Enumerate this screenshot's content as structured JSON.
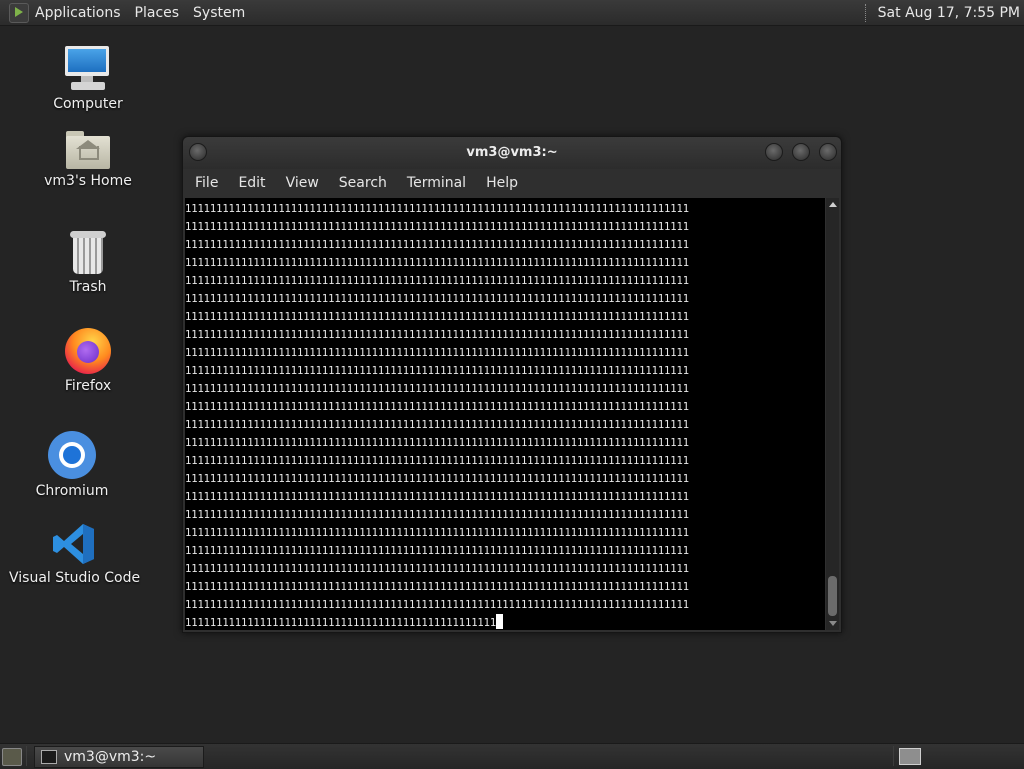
{
  "top_panel": {
    "menus": [
      "Applications",
      "Places",
      "System"
    ],
    "clock": "Sat Aug 17,  7:55 PM"
  },
  "desktop": {
    "icons": [
      {
        "label": "Computer",
        "icon": "computer-icon"
      },
      {
        "label": "vm3's Home",
        "icon": "home-folder-icon"
      },
      {
        "label": "Trash",
        "icon": "trash-icon"
      },
      {
        "label": "Firefox",
        "icon": "firefox-icon"
      },
      {
        "label": "Chromium",
        "icon": "chromium-icon"
      },
      {
        "label": "Visual Studio Code",
        "icon": "vscode-icon"
      }
    ]
  },
  "terminal": {
    "title": "vm3@vm3:~",
    "menus": [
      "File",
      "Edit",
      "View",
      "Search",
      "Terminal",
      "Help"
    ],
    "lines": [
      "111111111111111111111111111111111111111111111111111111111111111111111111111111111",
      "111111111111111111111111111111111111111111111111111111111111111111111111111111111",
      "111111111111111111111111111111111111111111111111111111111111111111111111111111111",
      "111111111111111111111111111111111111111111111111111111111111111111111111111111111",
      "111111111111111111111111111111111111111111111111111111111111111111111111111111111",
      "111111111111111111111111111111111111111111111111111111111111111111111111111111111",
      "111111111111111111111111111111111111111111111111111111111111111111111111111111111",
      "111111111111111111111111111111111111111111111111111111111111111111111111111111111",
      "111111111111111111111111111111111111111111111111111111111111111111111111111111111",
      "111111111111111111111111111111111111111111111111111111111111111111111111111111111",
      "111111111111111111111111111111111111111111111111111111111111111111111111111111111",
      "111111111111111111111111111111111111111111111111111111111111111111111111111111111",
      "111111111111111111111111111111111111111111111111111111111111111111111111111111111",
      "111111111111111111111111111111111111111111111111111111111111111111111111111111111",
      "111111111111111111111111111111111111111111111111111111111111111111111111111111111",
      "111111111111111111111111111111111111111111111111111111111111111111111111111111111",
      "111111111111111111111111111111111111111111111111111111111111111111111111111111111",
      "111111111111111111111111111111111111111111111111111111111111111111111111111111111",
      "111111111111111111111111111111111111111111111111111111111111111111111111111111111",
      "111111111111111111111111111111111111111111111111111111111111111111111111111111111",
      "111111111111111111111111111111111111111111111111111111111111111111111111111111111",
      "111111111111111111111111111111111111111111111111111111111111111111111111111111111",
      "111111111111111111111111111111111111111111111111111111111111111111111111111111111"
    ],
    "last_line": "11111111111111111111111111111111111111111111111111"
  },
  "bottom_panel": {
    "task_label": "vm3@vm3:~"
  }
}
